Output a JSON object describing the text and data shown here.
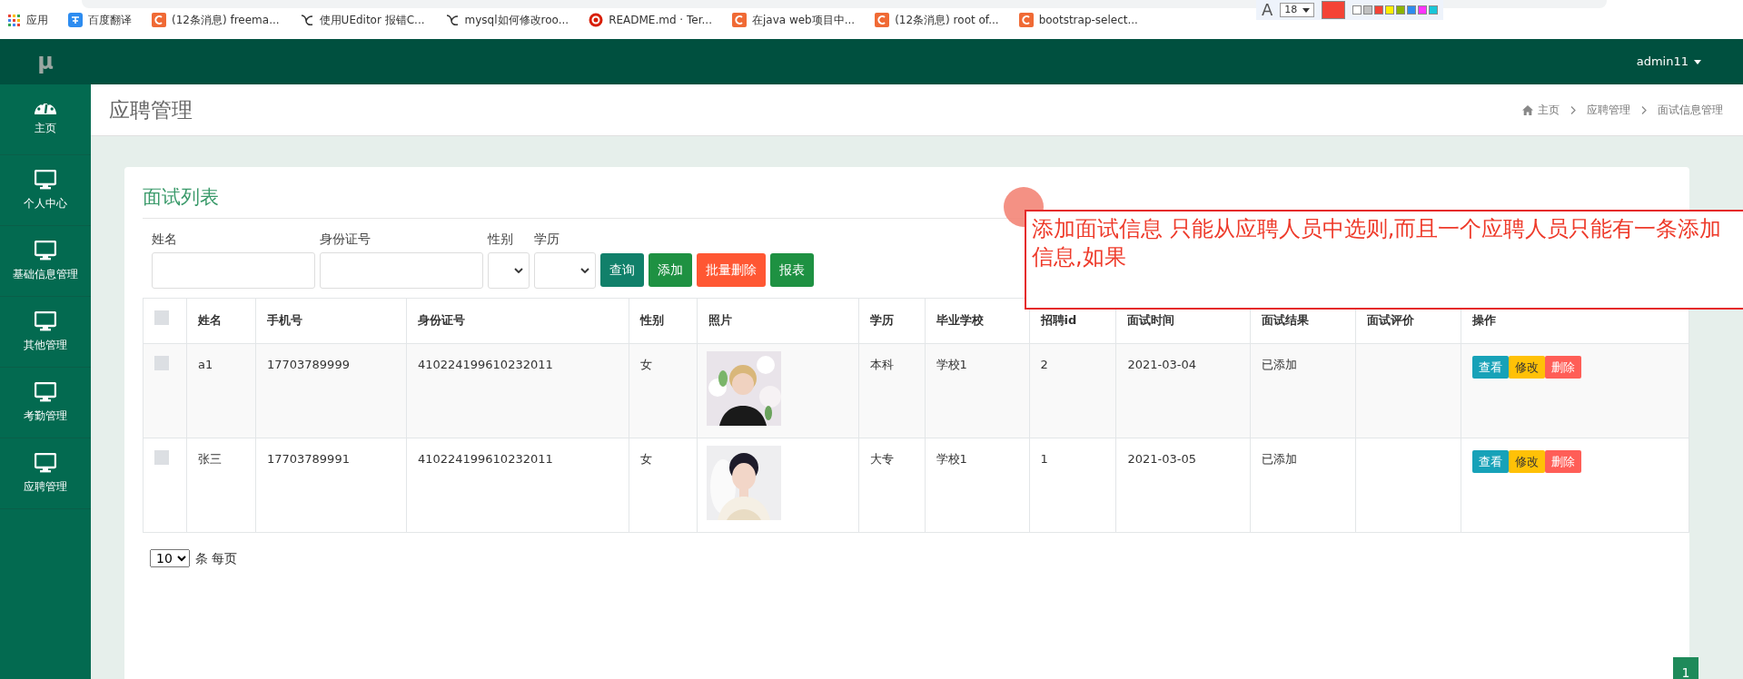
{
  "browser": {
    "bookmarks": [
      {
        "label": "应用",
        "kind": "grid"
      },
      {
        "label": "百度翻译",
        "kind": "translate"
      },
      {
        "label": "(12条消息) freema...",
        "kind": "csdn"
      },
      {
        "label": "使用UEditor 报错C...",
        "kind": "feather"
      },
      {
        "label": "mysql如何修改roo...",
        "kind": "feather"
      },
      {
        "label": "README.md · Ter...",
        "kind": "target"
      },
      {
        "label": "在java web项目中...",
        "kind": "csdn"
      },
      {
        "label": "(12条消息) root of...",
        "kind": "csdn"
      },
      {
        "label": "bootstrap-select...",
        "kind": "csdn"
      }
    ]
  },
  "annotation_toolbar": {
    "font_glyph": "A",
    "font_size": "18",
    "current_swatch": {
      "color": "#f44336"
    },
    "swatches": [
      {
        "color": "#ffffff"
      },
      {
        "color": "#c0c0c0"
      },
      {
        "color": "#f44336"
      },
      {
        "color": "#ffee00"
      },
      {
        "color": "#8cb400"
      },
      {
        "color": "#2d8cf0"
      },
      {
        "color": "#ff33ff"
      },
      {
        "color": "#18c6d8"
      }
    ]
  },
  "navbar": {
    "logo": "μ",
    "user": "admin11"
  },
  "sidebar": {
    "items": [
      {
        "label": "主页",
        "kind": "dashboard"
      },
      {
        "label": "个人中心",
        "kind": "monitor"
      },
      {
        "label": "基础信息管理",
        "kind": "monitor"
      },
      {
        "label": "其他管理",
        "kind": "monitor"
      },
      {
        "label": "考勤管理",
        "kind": "monitor"
      },
      {
        "label": "应聘管理",
        "kind": "monitor"
      }
    ]
  },
  "page_header": {
    "title": "应聘管理",
    "breadcrumb": [
      {
        "label": "主页",
        "kind": "home"
      },
      {
        "label": "应聘管理",
        "kind": "plain"
      },
      {
        "label": "面试信息管理",
        "kind": "plain"
      }
    ]
  },
  "card": {
    "title": "面试列表",
    "filters": [
      {
        "label": "姓名",
        "kind": "text"
      },
      {
        "label": "身份证号",
        "kind": "text"
      },
      {
        "label": "性别",
        "kind": "select"
      },
      {
        "label": "学历",
        "kind": "select"
      }
    ],
    "buttons": [
      {
        "label": "查询",
        "color": "#11806a"
      },
      {
        "label": "添加",
        "color": "#1e9142"
      },
      {
        "label": "批量删除",
        "color": "#ff5733"
      },
      {
        "label": "报表",
        "color": "#1e9142"
      }
    ],
    "table": {
      "select_all": {
        "checked": false
      },
      "columns": [
        "姓名",
        "手机号",
        "身份证号",
        "性别",
        "照片",
        "学历",
        "毕业学校",
        "招聘id",
        "面试时间",
        "面试结果",
        "面试评价",
        "操作"
      ],
      "rows": [
        {
          "checked": false,
          "cells": [
            "a1",
            "17703789999",
            "410224199610232011",
            "女",
            {
              "kind": "picture"
            },
            "本科",
            "学校1",
            "2",
            "2021-03-04",
            "已添加",
            ""
          ],
          "actions": [
            {
              "label": "查看",
              "color": "#17a2b8"
            },
            {
              "label": "修改",
              "color": "#ffc107"
            },
            {
              "label": "删除",
              "color": "#ff5e57"
            }
          ]
        },
        {
          "checked": false,
          "cells": [
            "张三",
            "17703789991",
            "410224199610232011",
            "女",
            {
              "kind": "picture"
            },
            "大专",
            "学校1",
            "1",
            "2021-03-05",
            "已添加",
            ""
          ],
          "actions": [
            {
              "label": "查看",
              "color": "#17a2b8"
            },
            {
              "label": "修改",
              "color": "#ffc107"
            },
            {
              "label": "删除",
              "color": "#ff5e57"
            }
          ]
        }
      ]
    },
    "pagination": {
      "page_size": "10",
      "page_size_label": "条 每页",
      "pages": [
        {
          "label": "1",
          "selected": true
        }
      ]
    }
  },
  "annotation": {
    "text": "添加面试信息 只能从应聘人员中选则,而且一个应聘人员只能有一条添加信息,如果"
  }
}
